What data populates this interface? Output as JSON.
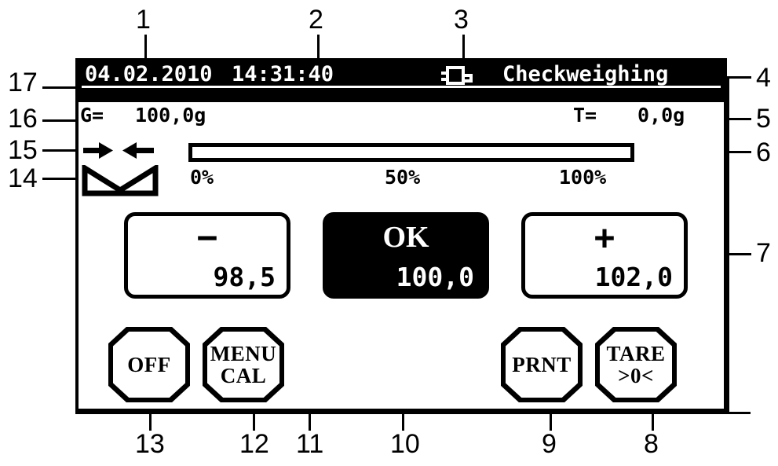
{
  "device": {
    "type": "checkweighing-scale-display",
    "status_bar": {
      "date": "04.02.2010",
      "time": "14:31:40",
      "connection_icon": "plug-icon",
      "mode": "Checkweighing"
    },
    "readout": {
      "gross_label": "G=",
      "gross_value": "100,0g",
      "tare_label": "T=",
      "tare_value": "0,0g"
    },
    "indicators": {
      "stability_icon": "arrows-inward-icon",
      "container_icon": "weighing-pan-icon"
    },
    "bargraph": {
      "fill_percent": 0,
      "scale_labels": [
        "0%",
        "50%",
        "100%"
      ]
    },
    "tolerance_buttons": [
      {
        "glyph": "−",
        "value": "98,5",
        "state": "outline",
        "name": "under-tolerance"
      },
      {
        "glyph": "OK",
        "value": "100,0",
        "state": "filled",
        "name": "in-tolerance"
      },
      {
        "glyph": "+",
        "value": "102,0",
        "state": "outline",
        "name": "over-tolerance"
      }
    ],
    "keys": [
      {
        "line1": "OFF",
        "line2": "",
        "name": "off"
      },
      {
        "line1": "MENU",
        "line2": "CAL",
        "name": "menu-cal"
      },
      {
        "line1": "PRNT",
        "line2": "",
        "name": "print"
      },
      {
        "line1": "TARE",
        "line2": ">0<",
        "name": "tare-zero"
      }
    ]
  },
  "callouts": {
    "top": [
      "1",
      "2",
      "3"
    ],
    "right": [
      "4",
      "5",
      "6",
      "7"
    ],
    "bottom": [
      "8",
      "9",
      "10",
      "11",
      "12",
      "13"
    ],
    "left": [
      "14",
      "15",
      "16",
      "17"
    ]
  },
  "colors": {
    "ink": "#000000",
    "paper": "#ffffff"
  }
}
